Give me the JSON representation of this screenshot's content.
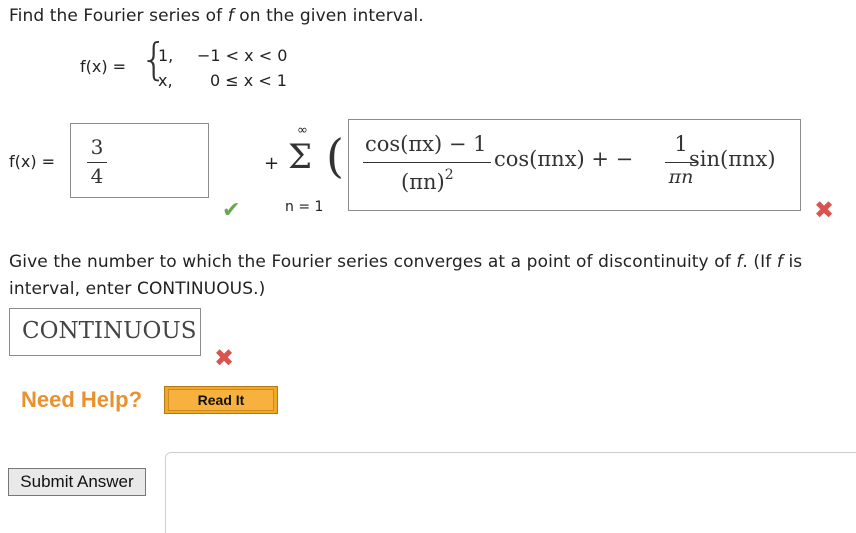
{
  "question": {
    "prompt_before_f": "Find the Fourier series of ",
    "f_var": "f",
    "prompt_after_f": " on the given interval."
  },
  "function_def": {
    "lhs": "f(x) =",
    "case1_value": "1,",
    "case1_condition": "−1 < x < 0",
    "case2_value": "x,",
    "case2_condition": "0 ≤ x < 1"
  },
  "series": {
    "lhs": "f(x) =",
    "a0_answer": {
      "numerator": "3",
      "denominator": "4"
    },
    "plus": "+",
    "sum_symbol": "Σ",
    "sum_upper": "∞",
    "sum_lower": "n = 1",
    "open_paren": "(",
    "coef_answer": {
      "num1": "cos(πx) − 1",
      "den1": "(πn)",
      "den1_exp": "2",
      "term1": "cos(πnx) + −",
      "num2": "1",
      "den2": "πn",
      "term2": "sin(πnx)"
    },
    "a0_status": "correct",
    "coef_status": "incorrect"
  },
  "question2": {
    "text_line1_a": "Give the number to which the Fourier series converges at a point of discontinuity of ",
    "text_line1_f1": "f",
    "text_line1_b": ". (If ",
    "text_line1_f2": "f",
    "text_line1_c": " is",
    "text_line2": "interval, enter CONTINUOUS.)",
    "answer": "CONTINUOUS",
    "status": "incorrect"
  },
  "help": {
    "label": "Need Help?",
    "read_it": "Read It"
  },
  "submit_label": "Submit Answer",
  "colors": {
    "correct": "#6aa84f",
    "incorrect": "#d9534f",
    "help_text": "#e8912f",
    "read_it_bg": "#f5a623"
  }
}
